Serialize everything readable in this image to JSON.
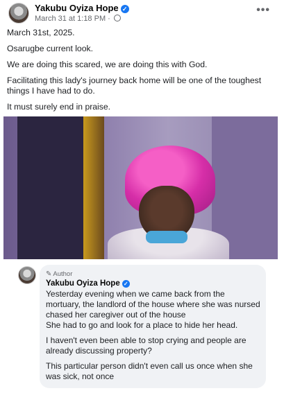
{
  "post": {
    "author": "Yakubu Oyiza Hope",
    "timestamp": "March 31 at 1:18 PM",
    "separator": "·",
    "more_icon": "•••",
    "body": [
      "March 31st, 2025.",
      "Osarugbe current look.",
      "We are doing this scared, we are doing this with God.",
      "Facilitating this lady's journey back home will be one of the toughest things I have had to do.",
      "It must surely end in praise."
    ]
  },
  "comment": {
    "badge": "Author",
    "author": "Yakubu Oyiza Hope",
    "paragraphs": [
      "Yesterday evening when we came back from the mortuary, the landlord of the house where she was nursed chased her caregiver out of the house\nShe had to go and look for a place to hide her head.",
      "I haven't even been able to stop crying and people are already discussing property?",
      "This particular person didn't even call us once when she was sick, not once"
    ]
  },
  "colors": {
    "verified": "#1877f2",
    "bonnet": "#d62ea8",
    "bubble": "#f0f2f5"
  }
}
